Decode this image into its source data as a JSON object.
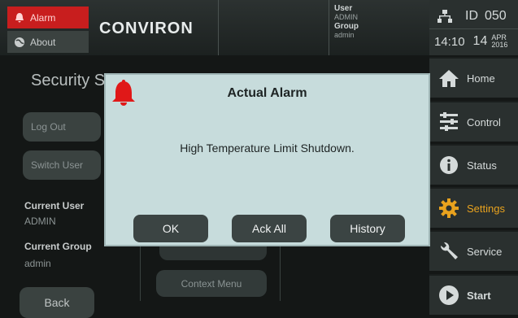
{
  "header": {
    "alarm_label": "Alarm",
    "about_label": "About",
    "logo_text": "CONVIRON",
    "user_label": "User",
    "user_value": "ADMIN",
    "group_label": "Group",
    "group_value": "admin",
    "id_label": "ID",
    "id_value": "050",
    "time": "14:10",
    "day": "14",
    "month": "APR",
    "year": "2016"
  },
  "page": {
    "title": "Security Setti",
    "log_out_label": "Log Out",
    "switch_user_label": "Switch User",
    "current_user_label": "Current User",
    "current_user_value": "ADMIN",
    "current_group_label": "Current Group",
    "current_group_value": "admin",
    "back_label": "Back",
    "context_menu_label": "Context Menu"
  },
  "nav": [
    {
      "label": "Home",
      "icon": "home-icon"
    },
    {
      "label": "Control",
      "icon": "control-icon"
    },
    {
      "label": "Status",
      "icon": "info-icon"
    },
    {
      "label": "Settings",
      "icon": "gear-icon"
    },
    {
      "label": "Service",
      "icon": "wrench-icon"
    },
    {
      "label": "Start",
      "icon": "play-icon"
    }
  ],
  "dialog": {
    "title": "Actual Alarm",
    "message": "High Temperature Limit Shutdown.",
    "ok_label": "OK",
    "ack_all_label": "Ack All",
    "history_label": "History"
  },
  "colors": {
    "alarm_red": "#c81e1e",
    "active_nav": "#e8a21e",
    "dialog_bg": "#c7dcdc"
  }
}
